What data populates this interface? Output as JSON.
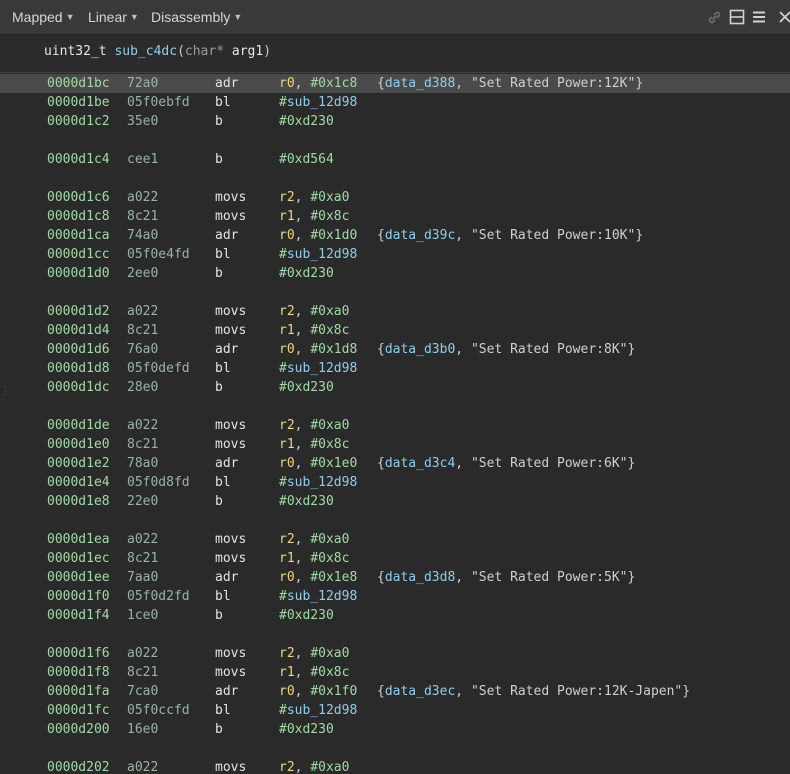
{
  "toolbar": {
    "view_mode": "Mapped",
    "layout_mode": "Linear",
    "view_type": "Disassembly"
  },
  "function": {
    "return_type": "uint32_t",
    "name": "sub_c4dc",
    "open_paren": "(",
    "param_type": "char*",
    "param_name": "arg1",
    "close_paren": ")"
  },
  "lines": [
    {
      "addr": "0000d1bc",
      "bytes": "72a0",
      "mn": "adr",
      "reg": "r0",
      "sep": ", ",
      "imm": "#0x1c8",
      "sym": "",
      "ann_open": "{",
      "ann_sym": "data_d388",
      "ann_sep": ", ",
      "ann_str": "\"Set Rated Power:12K\"",
      "ann_close": "}"
    },
    {
      "addr": "0000d1be",
      "bytes": "05f0ebfd",
      "mn": "bl",
      "reg": "",
      "sep": "",
      "imm": "#",
      "sym": "sub_12d98"
    },
    {
      "addr": "0000d1c2",
      "bytes": "35e0",
      "mn": "b",
      "reg": "",
      "sep": "",
      "imm": "#0xd230",
      "sym": ""
    },
    null,
    {
      "addr": "0000d1c4",
      "bytes": "cee1",
      "mn": "b",
      "reg": "",
      "sep": "",
      "imm": "#0xd564",
      "sym": ""
    },
    null,
    {
      "addr": "0000d1c6",
      "bytes": "a022",
      "mn": "movs",
      "reg": "r2",
      "sep": ", ",
      "imm": "#0xa0",
      "sym": ""
    },
    {
      "addr": "0000d1c8",
      "bytes": "8c21",
      "mn": "movs",
      "reg": "r1",
      "sep": ", ",
      "imm": "#0x8c",
      "sym": ""
    },
    {
      "addr": "0000d1ca",
      "bytes": "74a0",
      "mn": "adr",
      "reg": "r0",
      "sep": ", ",
      "imm": "#0x1d0",
      "sym": "",
      "ann_open": "{",
      "ann_sym": "data_d39c",
      "ann_sep": ", ",
      "ann_str": "\"Set Rated Power:10K\"",
      "ann_close": "}"
    },
    {
      "addr": "0000d1cc",
      "bytes": "05f0e4fd",
      "mn": "bl",
      "reg": "",
      "sep": "",
      "imm": "#",
      "sym": "sub_12d98"
    },
    {
      "addr": "0000d1d0",
      "bytes": "2ee0",
      "mn": "b",
      "reg": "",
      "sep": "",
      "imm": "#0xd230",
      "sym": ""
    },
    null,
    {
      "addr": "0000d1d2",
      "bytes": "a022",
      "mn": "movs",
      "reg": "r2",
      "sep": ", ",
      "imm": "#0xa0",
      "sym": ""
    },
    {
      "addr": "0000d1d4",
      "bytes": "8c21",
      "mn": "movs",
      "reg": "r1",
      "sep": ", ",
      "imm": "#0x8c",
      "sym": ""
    },
    {
      "addr": "0000d1d6",
      "bytes": "76a0",
      "mn": "adr",
      "reg": "r0",
      "sep": ", ",
      "imm": "#0x1d8",
      "sym": "",
      "ann_open": "{",
      "ann_sym": "data_d3b0",
      "ann_sep": ", ",
      "ann_str": "\"Set Rated Power:8K\"",
      "ann_close": "}"
    },
    {
      "addr": "0000d1d8",
      "bytes": "05f0defd",
      "mn": "bl",
      "reg": "",
      "sep": "",
      "imm": "#",
      "sym": "sub_12d98"
    },
    {
      "addr": "0000d1dc",
      "bytes": "28e0",
      "mn": "b",
      "reg": "",
      "sep": "",
      "imm": "#0xd230",
      "sym": ""
    },
    null,
    {
      "addr": "0000d1de",
      "bytes": "a022",
      "mn": "movs",
      "reg": "r2",
      "sep": ", ",
      "imm": "#0xa0",
      "sym": ""
    },
    {
      "addr": "0000d1e0",
      "bytes": "8c21",
      "mn": "movs",
      "reg": "r1",
      "sep": ", ",
      "imm": "#0x8c",
      "sym": ""
    },
    {
      "addr": "0000d1e2",
      "bytes": "78a0",
      "mn": "adr",
      "reg": "r0",
      "sep": ", ",
      "imm": "#0x1e0",
      "sym": "",
      "ann_open": "{",
      "ann_sym": "data_d3c4",
      "ann_sep": ", ",
      "ann_str": "\"Set Rated Power:6K\"",
      "ann_close": "}"
    },
    {
      "addr": "0000d1e4",
      "bytes": "05f0d8fd",
      "mn": "bl",
      "reg": "",
      "sep": "",
      "imm": "#",
      "sym": "sub_12d98"
    },
    {
      "addr": "0000d1e8",
      "bytes": "22e0",
      "mn": "b",
      "reg": "",
      "sep": "",
      "imm": "#0xd230",
      "sym": ""
    },
    null,
    {
      "addr": "0000d1ea",
      "bytes": "a022",
      "mn": "movs",
      "reg": "r2",
      "sep": ", ",
      "imm": "#0xa0",
      "sym": ""
    },
    {
      "addr": "0000d1ec",
      "bytes": "8c21",
      "mn": "movs",
      "reg": "r1",
      "sep": ", ",
      "imm": "#0x8c",
      "sym": ""
    },
    {
      "addr": "0000d1ee",
      "bytes": "7aa0",
      "mn": "adr",
      "reg": "r0",
      "sep": ", ",
      "imm": "#0x1e8",
      "sym": "",
      "ann_open": "{",
      "ann_sym": "data_d3d8",
      "ann_sep": ", ",
      "ann_str": "\"Set Rated Power:5K\"",
      "ann_close": "}"
    },
    {
      "addr": "0000d1f0",
      "bytes": "05f0d2fd",
      "mn": "bl",
      "reg": "",
      "sep": "",
      "imm": "#",
      "sym": "sub_12d98"
    },
    {
      "addr": "0000d1f4",
      "bytes": "1ce0",
      "mn": "b",
      "reg": "",
      "sep": "",
      "imm": "#0xd230",
      "sym": ""
    },
    null,
    {
      "addr": "0000d1f6",
      "bytes": "a022",
      "mn": "movs",
      "reg": "r2",
      "sep": ", ",
      "imm": "#0xa0",
      "sym": ""
    },
    {
      "addr": "0000d1f8",
      "bytes": "8c21",
      "mn": "movs",
      "reg": "r1",
      "sep": ", ",
      "imm": "#0x8c",
      "sym": ""
    },
    {
      "addr": "0000d1fa",
      "bytes": "7ca0",
      "mn": "adr",
      "reg": "r0",
      "sep": ", ",
      "imm": "#0x1f0",
      "sym": "",
      "ann_open": "{",
      "ann_sym": "data_d3ec",
      "ann_sep": ", ",
      "ann_str": "\"Set Rated Power:12K-Japen\"",
      "ann_close": "}"
    },
    {
      "addr": "0000d1fc",
      "bytes": "05f0ccfd",
      "mn": "bl",
      "reg": "",
      "sep": "",
      "imm": "#",
      "sym": "sub_12d98"
    },
    {
      "addr": "0000d200",
      "bytes": "16e0",
      "mn": "b",
      "reg": "",
      "sep": "",
      "imm": "#0xd230",
      "sym": ""
    },
    null,
    {
      "addr": "0000d202",
      "bytes": "a022",
      "mn": "movs",
      "reg": "r2",
      "sep": ", ",
      "imm": "#0xa0",
      "sym": ""
    }
  ],
  "highlighted_line": 0,
  "icons": [
    "link-icon",
    "split-view-icon",
    "menu-icon",
    "close-icon"
  ],
  "colors": {
    "address": "#a1d9a6",
    "register": "#f1d37c",
    "symbol": "#8fcdea",
    "highlight": "#4a4a4a",
    "background": "#2a2a2a"
  }
}
